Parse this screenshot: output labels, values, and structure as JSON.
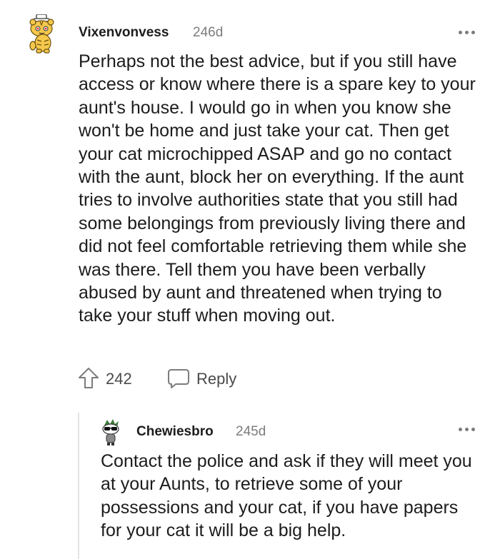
{
  "comment": {
    "username": "Vixenvonvess",
    "age": "246d",
    "body": "Perhaps not the best advice, but if you still have access or know where there is a spare key to your aunt's house. I would go in when you know she won't be home and just take your cat. Then get your cat microchipped ASAP and go no contact with the aunt, block her on everything. If the aunt tries to involve authorities state that you still had some belongings from previously living there and did not feel comfortable retrieving them while she was there. Tell them you have been verbally abused by aunt and threatened when trying to take your stuff when moving out.",
    "score": "242",
    "reply_label": "Reply",
    "avatar_icon": "tiger-snoo-avatar-icon",
    "more_icon": "more-options-icon"
  },
  "reply": {
    "username": "Chewiesbro",
    "age": "245d",
    "body": "Contact the police and ask if they will meet you at your Aunts, to retrieve some of your possessions and your cat, if you have papers for your cat it will be a big help.",
    "avatar_icon": "sunglasses-snoo-avatar-icon",
    "more_icon": "more-options-icon"
  },
  "colors": {
    "text": "#1c1c1c",
    "meta": "#7c7c7c",
    "thread_line": "#e4e4e4",
    "avatar_main": "#f5c84c"
  }
}
